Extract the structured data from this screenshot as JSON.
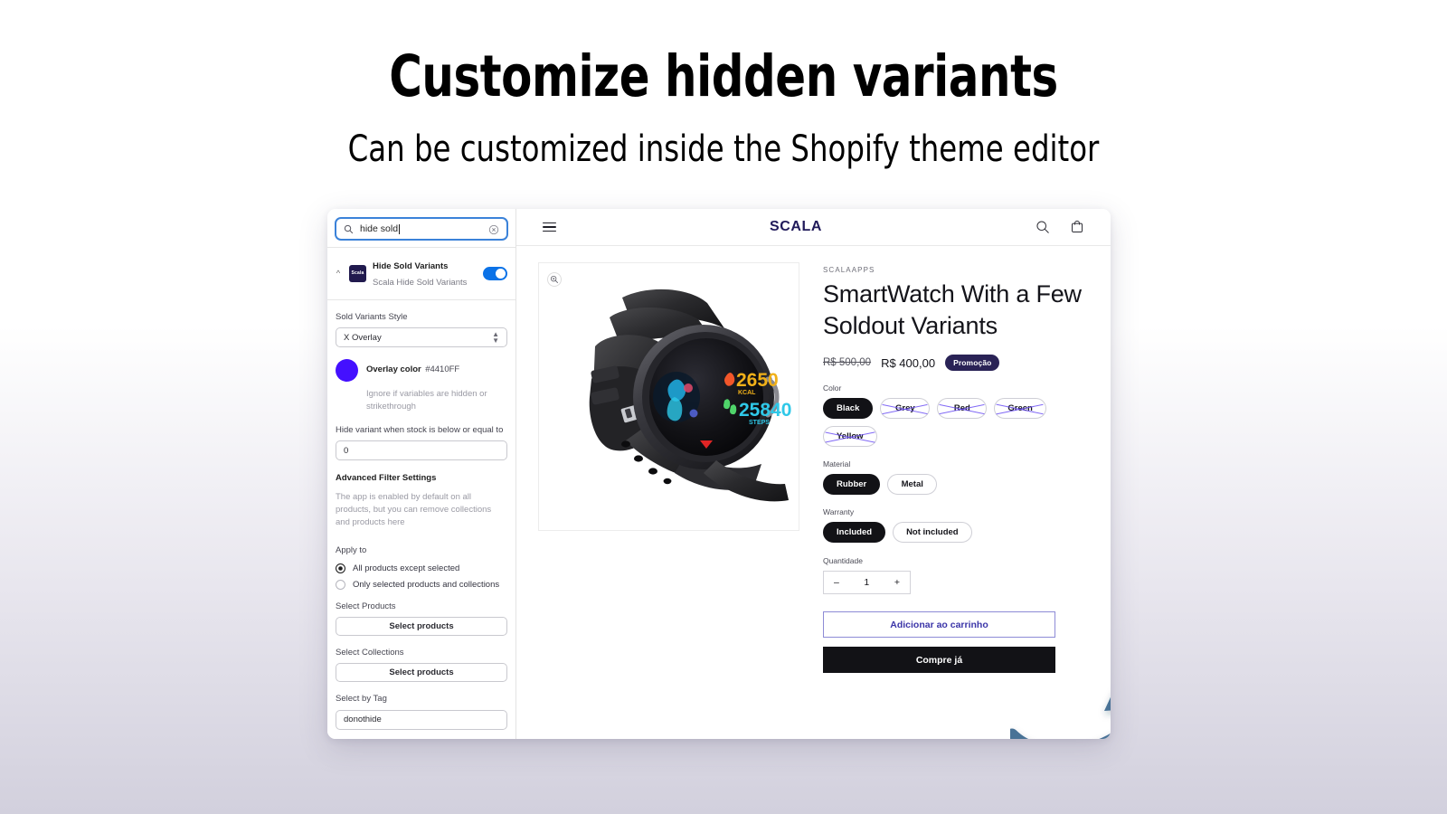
{
  "headline": {
    "title": "Customize hidden variants",
    "subtitle": "Can be customized inside the Shopify theme editor"
  },
  "colors": {
    "overlay_accent": "#4410FF",
    "toggle_on": "#0b72e7",
    "brand_navy": "#201a5a",
    "badge": "#2a2356",
    "arrow": "#4a7296"
  },
  "sidebar": {
    "search": {
      "value": "hide sold",
      "icon": "search-icon",
      "clear_icon": "clear-circle-icon"
    },
    "app": {
      "icon_label": "Scala",
      "title": "Hide Sold Variants",
      "subtitle": "Scala Hide Sold Variants",
      "collapse_icon": "chevron-up-icon",
      "toggle_state": "on"
    },
    "style_field": {
      "label": "Sold Variants Style",
      "value": "X Overlay"
    },
    "overlay_color": {
      "name": "Overlay color",
      "hex": "#4410FF",
      "note": "Ignore if variables are hidden or strikethrough"
    },
    "stock_field": {
      "label": "Hide variant when stock is below or equal to",
      "value": "0"
    },
    "advanced": {
      "title": "Advanced Filter Settings",
      "note": "The app is enabled by default on all products, but you can remove collections and products here"
    },
    "apply_to": {
      "label": "Apply to",
      "options": [
        {
          "label": "All products except selected",
          "selected": true
        },
        {
          "label": "Only selected products and collections",
          "selected": false
        }
      ]
    },
    "select_products": {
      "label": "Select Products",
      "button": "Select products"
    },
    "select_collections": {
      "label": "Select Collections",
      "button": "Select products"
    },
    "select_by_tag": {
      "label": "Select by Tag",
      "value": "donothide"
    }
  },
  "store": {
    "header": {
      "menu_icon": "hamburger-menu-icon",
      "logo": "SCALA",
      "search_icon": "search-icon",
      "cart_icon": "shopping-bag-icon"
    },
    "gallery": {
      "zoom_icon": "zoom-in-icon"
    },
    "product": {
      "vendor": "SCALAAPPS",
      "title": "SmartWatch With a Few Soldout Variants",
      "price_compare": "R$ 500,00",
      "price": "R$ 400,00",
      "badge": "Promoção",
      "options": [
        {
          "label": "Color",
          "values": [
            {
              "label": "Black",
              "selected": true,
              "sold_out": false
            },
            {
              "label": "Grey",
              "selected": false,
              "sold_out": true
            },
            {
              "label": "Red",
              "selected": false,
              "sold_out": true
            },
            {
              "label": "Green",
              "selected": false,
              "sold_out": true
            },
            {
              "label": "Yellow",
              "selected": false,
              "sold_out": true
            }
          ]
        },
        {
          "label": "Material",
          "values": [
            {
              "label": "Rubber",
              "selected": true,
              "sold_out": false
            },
            {
              "label": "Metal",
              "selected": false,
              "sold_out": false
            }
          ]
        },
        {
          "label": "Warranty",
          "values": [
            {
              "label": "Included",
              "selected": true,
              "sold_out": false
            },
            {
              "label": "Not included",
              "selected": false,
              "sold_out": false
            }
          ]
        }
      ],
      "quantity": {
        "label": "Quantidade",
        "value": "1",
        "minus": "–",
        "plus": "+"
      },
      "add_to_cart": "Adicionar ao carrinho",
      "buy_now": "Compre já"
    },
    "watch_display": {
      "calories": "2650",
      "calories_unit": "KCAL",
      "steps": "25840",
      "steps_unit": "STEPS"
    }
  }
}
